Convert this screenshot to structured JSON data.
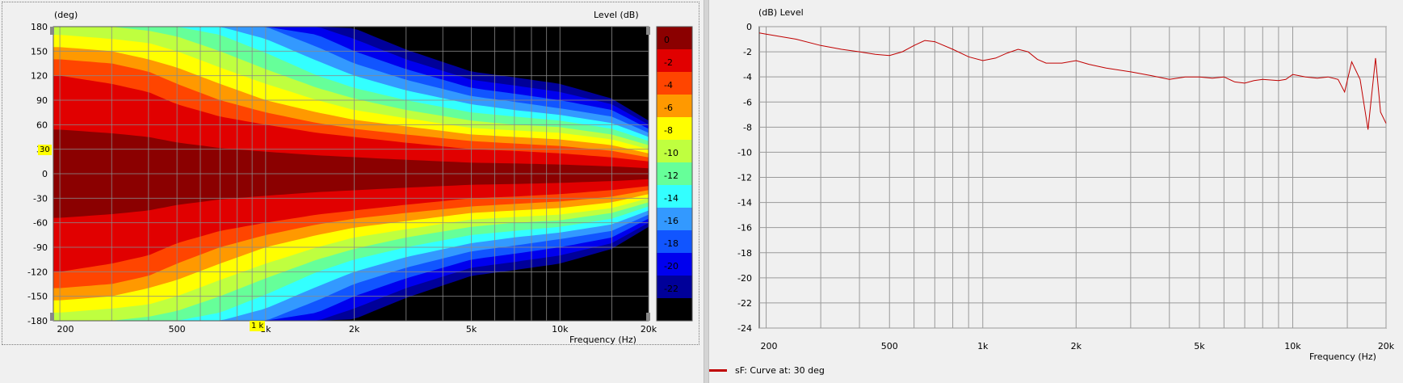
{
  "left_chart": {
    "y_unit": "(deg)",
    "level_label": "Level  (dB)",
    "freq_label": "Frequency  (Hz)",
    "y_ticks": [
      "180",
      "150",
      "120",
      "90",
      "60",
      "30",
      "0",
      "-30",
      "-60",
      "-90",
      "-120",
      "-150",
      "-180"
    ],
    "x_ticks": [
      "200",
      "500",
      "1k",
      "2k",
      "5k",
      "10k",
      "20k"
    ],
    "x_tick_values": [
      200,
      500,
      1000,
      2000,
      5000,
      10000,
      20000
    ],
    "colorbar_ticks": [
      "0",
      "-2",
      "-4",
      "-6",
      "-8",
      "-10",
      "-12",
      "-14",
      "-16",
      "-18",
      "-20",
      "-22",
      "-24"
    ],
    "colorbar_colors": [
      "#8b0000",
      "#e10000",
      "#ff4500",
      "#ff9900",
      "#ffff00",
      "#bfff3f",
      "#66ff99",
      "#33ffff",
      "#3399ff",
      "#1155ff",
      "#0000ee",
      "#000099",
      "#000000"
    ],
    "cursor_angle_label": "30",
    "cursor_freq_label": "1 k"
  },
  "right_chart": {
    "y_unit": "(dB)  Level",
    "freq_label": "Frequency  (Hz)",
    "y_ticks": [
      "0",
      "-2",
      "-4",
      "-6",
      "-8",
      "-10",
      "-12",
      "-14",
      "-16",
      "-18",
      "-20",
      "-22",
      "-24"
    ],
    "x_ticks": [
      "200",
      "500",
      "1k",
      "2k",
      "5k",
      "10k",
      "20k"
    ],
    "x_tick_values": [
      200,
      500,
      1000,
      2000,
      5000,
      10000,
      20000
    ],
    "curve_color": "#c00000",
    "legend_label": "sF: Curve at: 30 deg"
  },
  "chart_data": [
    {
      "type": "heatmap",
      "xlabel": "Frequency  (Hz)",
      "ylabel": "(deg)",
      "x_scale": "log",
      "xlim": [
        190,
        20000
      ],
      "ylim": [
        -180,
        180
      ],
      "colorbar_label": "Level  (dB)",
      "colorbar_range": [
        -24,
        0
      ],
      "beamwidth_contours": {
        "freqs": [
          200,
          300,
          400,
          500,
          700,
          1000,
          1500,
          2000,
          3000,
          5000,
          7000,
          10000,
          15000,
          20000
        ],
        "bands": [
          {
            "level": -2,
            "half_angle": [
              120,
              110,
              100,
              85,
              70,
              60,
              50,
              45,
              38,
              30,
              28,
              25,
              20,
              15
            ]
          },
          {
            "level": -4,
            "half_angle": [
              140,
              135,
              125,
              110,
              90,
              75,
              62,
              55,
              48,
              40,
              37,
              34,
              28,
              20
            ]
          },
          {
            "level": -6,
            "half_angle": [
              155,
              150,
              140,
              130,
              110,
              90,
              75,
              66,
              58,
              48,
              45,
              42,
              35,
              25
            ]
          },
          {
            "level": -8,
            "half_angle": [
              170,
              165,
              160,
              150,
              130,
              110,
              90,
              78,
              68,
              56,
              53,
              50,
              42,
              30
            ]
          },
          {
            "level": -10,
            "half_angle": [
              180,
              180,
              175,
              168,
              150,
              128,
              105,
              92,
              78,
              65,
              60,
              57,
              48,
              35
            ]
          },
          {
            "level": -12,
            "half_angle": [
              180,
              180,
              180,
              180,
              170,
              148,
              120,
              105,
              90,
              75,
              70,
              65,
              55,
              40
            ]
          },
          {
            "level": -14,
            "half_angle": [
              180,
              180,
              180,
              180,
              180,
              165,
              138,
              120,
              102,
              85,
              78,
              72,
              62,
              45
            ]
          },
          {
            "level": -16,
            "half_angle": [
              180,
              180,
              180,
              180,
              180,
              180,
              155,
              135,
              115,
              95,
              88,
              80,
              70,
              50
            ]
          },
          {
            "level": -18,
            "half_angle": [
              180,
              180,
              180,
              180,
              180,
              180,
              170,
              150,
              128,
              105,
              98,
              90,
              78,
              55
            ]
          },
          {
            "level": -20,
            "half_angle": [
              180,
              180,
              180,
              180,
              180,
              180,
              180,
              165,
              140,
              115,
              108,
              100,
              85,
              60
            ]
          },
          {
            "level": -22,
            "half_angle": [
              180,
              180,
              180,
              180,
              180,
              180,
              180,
              178,
              152,
              125,
              118,
              110,
              92,
              65
            ]
          }
        ]
      }
    },
    {
      "type": "line",
      "xlabel": "Frequency  (Hz)",
      "ylabel": "(dB)  Level",
      "x_scale": "log",
      "xlim": [
        190,
        20000
      ],
      "ylim": [
        -24,
        0
      ],
      "grid": true,
      "legend": "bottom-left",
      "series": [
        {
          "name": "sF: Curve at: 30 deg",
          "x": [
            190,
            200,
            250,
            300,
            350,
            400,
            450,
            500,
            550,
            600,
            650,
            700,
            800,
            900,
            1000,
            1100,
            1200,
            1300,
            1400,
            1500,
            1600,
            1800,
            2000,
            2200,
            2500,
            3000,
            3500,
            4000,
            4500,
            5000,
            5500,
            6000,
            6500,
            7000,
            7500,
            8000,
            9000,
            9500,
            10000,
            11000,
            12000,
            13000,
            14000,
            14700,
            15500,
            16500,
            17500,
            18500,
            19200,
            20000
          ],
          "y": [
            -0.5,
            -0.6,
            -1.0,
            -1.5,
            -1.8,
            -2.0,
            -2.2,
            -2.3,
            -2.0,
            -1.5,
            -1.1,
            -1.2,
            -1.8,
            -2.4,
            -2.7,
            -2.5,
            -2.1,
            -1.8,
            -2.0,
            -2.6,
            -2.9,
            -2.9,
            -2.7,
            -3.0,
            -3.3,
            -3.6,
            -3.9,
            -4.2,
            -4.0,
            -4.0,
            -4.1,
            -4.0,
            -4.4,
            -4.5,
            -4.3,
            -4.2,
            -4.3,
            -4.2,
            -3.8,
            -4.0,
            -4.1,
            -4.0,
            -4.2,
            -5.2,
            -2.8,
            -4.2,
            -8.2,
            -2.5,
            -6.8,
            -7.7
          ]
        }
      ]
    }
  ]
}
